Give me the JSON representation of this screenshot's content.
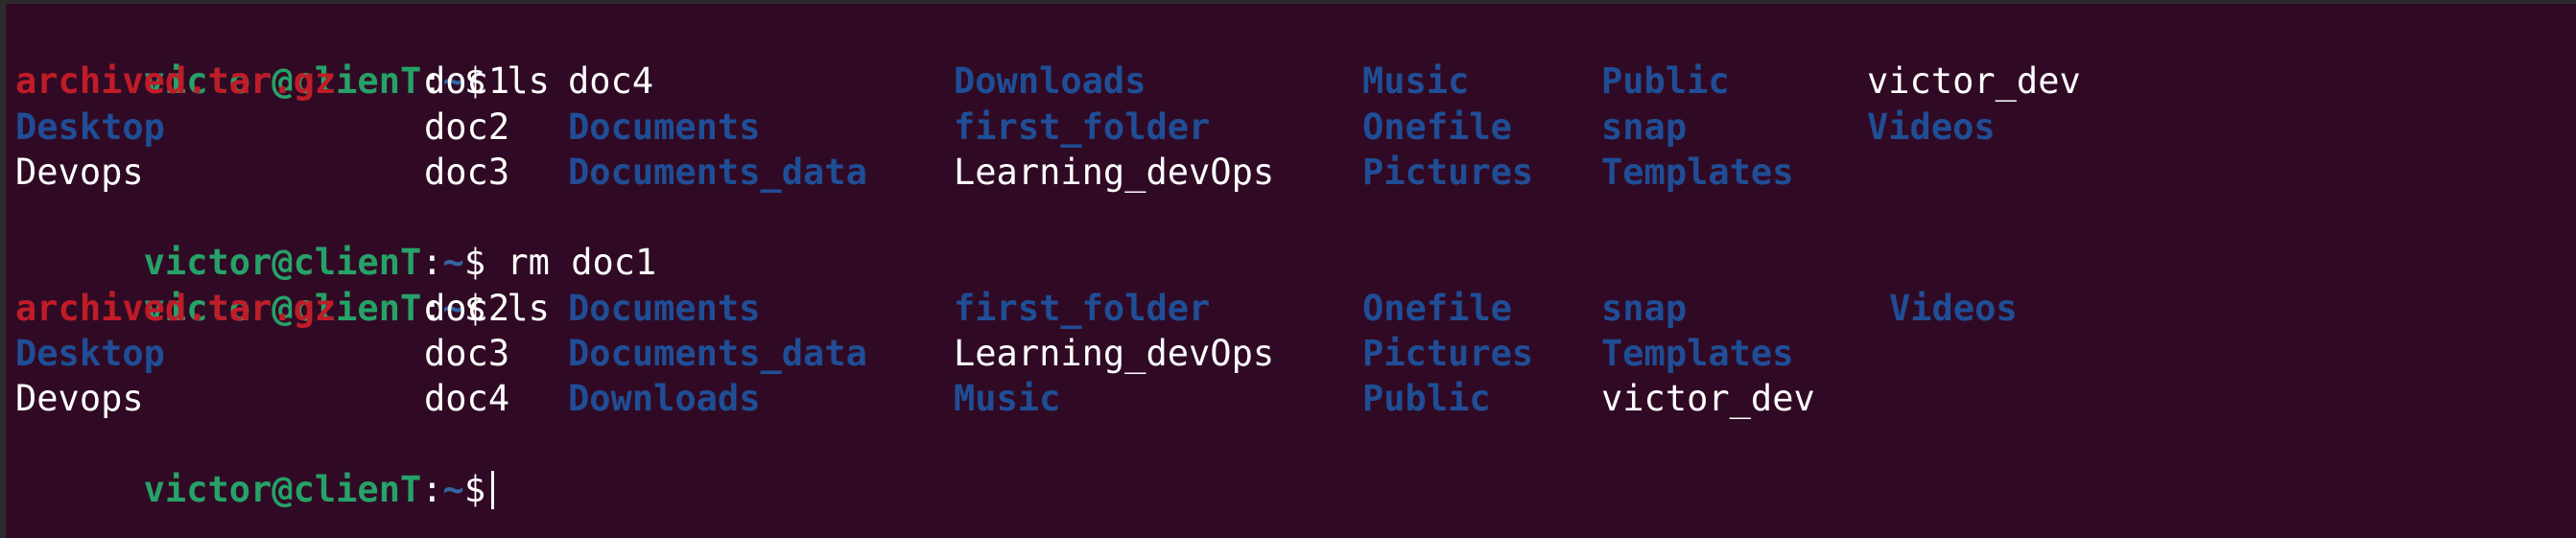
{
  "prompt": {
    "user_host": "victor@clienT",
    "colon": ":",
    "path": "~",
    "dollar": "$"
  },
  "commands": {
    "ls1": " ls",
    "rm": " rm doc1",
    "ls2": " ls"
  },
  "listing1": {
    "row1": [
      "archived.tar.gz",
      "doc1",
      "doc4",
      "Downloads",
      "Music",
      "Public",
      "victor_dev"
    ],
    "row2": [
      "Desktop",
      "doc2",
      "Documents",
      "first_folder",
      "Onefile",
      "snap",
      "Videos"
    ],
    "row3": [
      "Devops",
      "doc3",
      "Documents_data",
      "Learning_devOps",
      "Pictures",
      "Templates"
    ]
  },
  "listing2": {
    "row1": [
      "archived.tar.gz",
      "doc2",
      "Documents",
      "first_folder",
      "Onefile",
      "snap",
      "Videos"
    ],
    "row2": [
      "Desktop",
      "doc3",
      "Documents_data",
      "Learning_devOps",
      "Pictures",
      "Templates"
    ],
    "row3": [
      "Devops",
      "doc4",
      "Downloads",
      "Music",
      "Public",
      "victor_dev"
    ]
  },
  "colors": {
    "background": "#300a24",
    "prompt_user": "#26a269",
    "prompt_path": "#3465a4",
    "directory": "#1f4e96",
    "archive": "#c01c28",
    "text": "#ffffff"
  }
}
